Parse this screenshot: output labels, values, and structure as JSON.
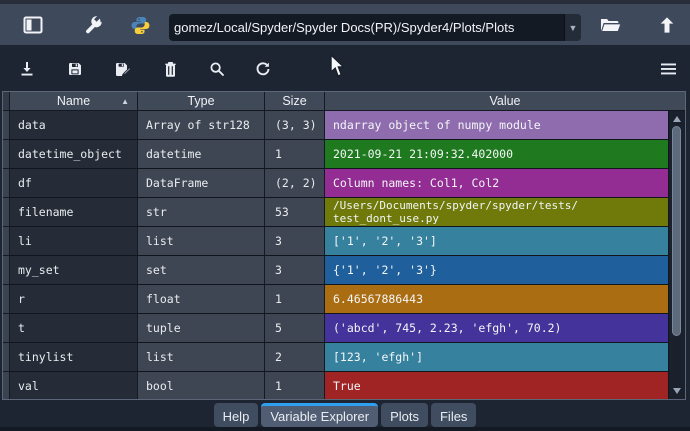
{
  "window": {
    "path_value": "gomez/Local/Spyder/Spyder Docs(PR)/Spyder4/Plots/Plots",
    "dropdown_caret": "▼",
    "top_icons": [
      "panel-layout-icon",
      "wrench-icon",
      "python-logo-icon",
      "open-folder-icon",
      "up-arrow-icon"
    ]
  },
  "toolbar": {
    "icons": [
      "import-data-icon",
      "save-icon",
      "save-as-icon",
      "remove-variable-icon",
      "search-icon",
      "refresh-icon",
      "options-menu-icon"
    ]
  },
  "variable_explorer": {
    "columns": [
      "Name",
      "Type",
      "Size",
      "Value"
    ],
    "sort_indicator": "▲",
    "rows": [
      {
        "name": "data",
        "type": "Array of str128",
        "size": "(3, 3)",
        "value": "ndarray object of numpy module",
        "color": "#8e6cae"
      },
      {
        "name": "datetime_object",
        "type": "datetime",
        "size": "1",
        "value": "2021-09-21 21:09:32.402000",
        "color": "#1f7a1f"
      },
      {
        "name": "df",
        "type": "DataFrame",
        "size": "(2, 2)",
        "value": "Column names: Col1, Col2",
        "color": "#932d93"
      },
      {
        "name": "filename",
        "type": "str",
        "size": "53",
        "value": "/Users/Documents/spyder/spyder/tests/\ntest_dont_use.py",
        "color": "#6f7a0a"
      },
      {
        "name": "li",
        "type": "list",
        "size": "3",
        "value": "['1', '2', '3']",
        "color": "#35819e"
      },
      {
        "name": "my_set",
        "type": "set",
        "size": "3",
        "value": "{'1', '2', '3'}",
        "color": "#1e5f9c"
      },
      {
        "name": "r",
        "type": "float",
        "size": "1",
        "value": "6.46567886443",
        "color": "#ab6d12"
      },
      {
        "name": "t",
        "type": "tuple",
        "size": "5",
        "value": "('abcd', 745, 2.23, 'efgh', 70.2)",
        "color": "#43339b"
      },
      {
        "name": "tinylist",
        "type": "list",
        "size": "2",
        "value": "[123, 'efgh']",
        "color": "#35819e"
      },
      {
        "name": "val",
        "type": "bool",
        "size": "1",
        "value": "True",
        "color": "#a02424"
      }
    ]
  },
  "tabs": {
    "items": [
      "Help",
      "Variable Explorer",
      "Plots",
      "Files"
    ],
    "active": "Variable Explorer"
  },
  "colors": {
    "accent_blue": "#2f9ff0",
    "toolbar_top_bg": "#3e4a5c",
    "panel_bg": "#1d2533",
    "header_bg": "#404958",
    "name_cell_bg": "#262c37",
    "type_cell_bg": "#3f4653"
  }
}
